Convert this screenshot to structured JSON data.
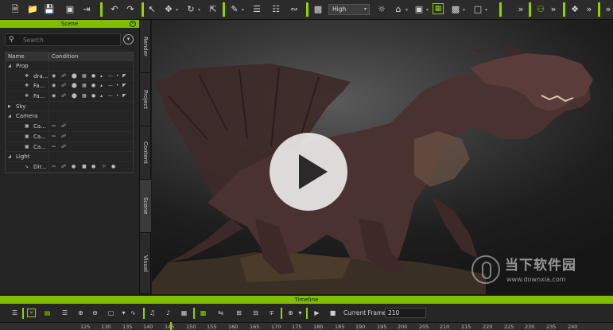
{
  "toolbar": {
    "quality_value": "High",
    "more_label": "»"
  },
  "scene_panel": {
    "title": "Scene",
    "search_placeholder": "Search",
    "columns": [
      "Name",
      "Condition"
    ],
    "rows": [
      {
        "label": "Prop",
        "kind": "group"
      },
      {
        "label": "dra...",
        "kind": "item"
      },
      {
        "label": "Fa...",
        "kind": "item"
      },
      {
        "label": "Fa...",
        "kind": "item"
      },
      {
        "label": "Sky",
        "kind": "group-collapsed"
      },
      {
        "label": "Camera",
        "kind": "group"
      },
      {
        "label": "Ca...",
        "kind": "item"
      },
      {
        "label": "Ca...",
        "kind": "item"
      },
      {
        "label": "Ca...",
        "kind": "item"
      },
      {
        "label": "Light",
        "kind": "group"
      },
      {
        "label": "Dir...",
        "kind": "item"
      }
    ]
  },
  "side_tabs": [
    "Render",
    "Project",
    "Content",
    "Scene",
    "Visual"
  ],
  "watermark": {
    "text_cn": "当下软件园",
    "url": "www.downxia.com"
  },
  "timeline": {
    "title": "Timeline",
    "current_frame_label": "Current Frame :",
    "current_frame_value": "210",
    "ticks": [
      "125",
      "130",
      "135",
      "140",
      "145",
      "150",
      "155",
      "160",
      "165",
      "170",
      "175",
      "180",
      "185",
      "190",
      "195",
      "200",
      "205",
      "210",
      "215",
      "220",
      "225",
      "230",
      "235",
      "240"
    ]
  },
  "colors": {
    "accent": "#7fbf00",
    "panel_bg": "#242424",
    "toolbar_bg": "#2b2b2b"
  }
}
